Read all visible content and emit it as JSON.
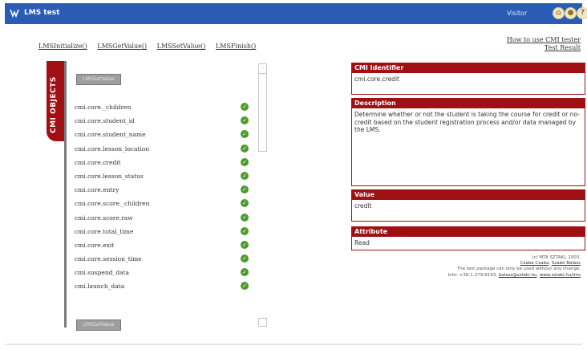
{
  "app": {
    "title": "LMS test",
    "user": "Visitor",
    "icons": [
      "home-icon",
      "settings-icon",
      "help-icon"
    ],
    "accent": "#9f0f13",
    "header_color": "#2a5cb4"
  },
  "api_links": [
    "LMSInitialize()",
    "LMSGetValue()",
    "LMSSetValue()",
    "LMSFinish()"
  ],
  "top_links": [
    "How to use CMI tester",
    "Test Result"
  ],
  "objects": {
    "tab_label": "CMI OBJECTS",
    "top_button": "LMSGetValue",
    "bottom_button": "LMSSetValue",
    "items": [
      {
        "label": "cmi.core._children"
      },
      {
        "label": "cmi.core.student_id"
      },
      {
        "label": "cmi.core.student_name"
      },
      {
        "label": "cmi.core.lesson_location"
      },
      {
        "label": "cmi.core.credit"
      },
      {
        "label": "cmi.core.lesson_status"
      },
      {
        "label": "cmi.core.entry"
      },
      {
        "label": "cmi.core.score._children"
      },
      {
        "label": "cmi.core.score.raw"
      },
      {
        "label": "cmi.core.total_time"
      },
      {
        "label": "cmi.core.exit"
      },
      {
        "label": "cmi.core.session_time"
      },
      {
        "label": "cmi.suspend_data"
      },
      {
        "label": "cmi.launch_data"
      }
    ]
  },
  "detail": {
    "identifier_label": "CMI Identifier",
    "identifier_value": "cmi.core.credit",
    "description_label": "Description",
    "description_value": "Determine whether or not the student is taking the course for credit or no-credit based on the student registration process and/or data managed by the LMS.",
    "value_label": "Value",
    "value_value": "credit",
    "attribute_label": "Attribute",
    "attribute_value": "Read"
  },
  "credits": {
    "line1": "(c) MTA SZTAKI, 2003.",
    "line2_a": "Csaba Csaba",
    "line2_b": "Szabó Balázs",
    "line3": "The test package can only be used without any change.",
    "line4": "Info: +36-1-279-6193,",
    "email": "balasz@sztaki.hu",
    "site": "www.sztaki.hu/lms"
  }
}
